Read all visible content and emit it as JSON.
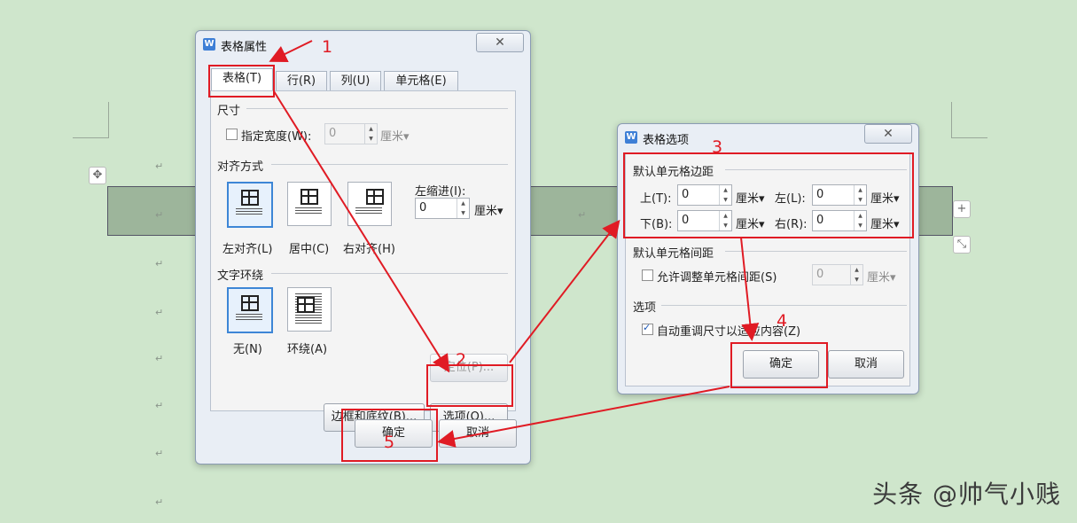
{
  "table_properties": {
    "title": "表格属性",
    "close": "✕",
    "tabs": [
      "表格(T)",
      "行(R)",
      "列(U)",
      "单元格(E)"
    ],
    "size_group": "尺寸",
    "specify_width": "指定宽度(W):",
    "width_value": "0",
    "width_unit": "厘米▾",
    "align_group": "对齐方式",
    "align_left": "左对齐(L)",
    "align_center": "居中(C)",
    "align_right": "右对齐(H)",
    "left_indent": "左缩进(I):",
    "indent_value": "0",
    "indent_unit": "厘米▾",
    "wrap_group": "文字环绕",
    "wrap_none": "无(N)",
    "wrap_around": "环绕(A)",
    "position_btn": "定位(P)...",
    "borders_btn": "边框和底纹(B)...",
    "options_btn": "选项(O)...",
    "ok": "确定",
    "cancel": "取消"
  },
  "table_options": {
    "title": "表格选项",
    "close": "✕",
    "margins_group": "默认单元格边距",
    "top": "上(T):",
    "top_value": "0",
    "left": "左(L):",
    "left_value": "0",
    "bottom": "下(B):",
    "bottom_value": "0",
    "right": "右(R):",
    "right_value": "0",
    "unit": "厘米▾",
    "spacing_group": "默认单元格间距",
    "allow_spacing": "允许调整单元格间距(S)",
    "spacing_value": "0",
    "options_group": "选项",
    "auto_resize": "自动重调尺寸以适应内容(Z)",
    "ok": "确定",
    "cancel": "取消"
  },
  "annotations": [
    "1",
    "2",
    "3",
    "4",
    "5"
  ],
  "watermark": "头条 @帅气小贱",
  "doc": {
    "para_mark": "↵",
    "side_plus": "+",
    "resize": "⤡",
    "move": "✥"
  },
  "colors": {
    "annotation_red": "#e01b24",
    "background": "#cfe6cc"
  }
}
